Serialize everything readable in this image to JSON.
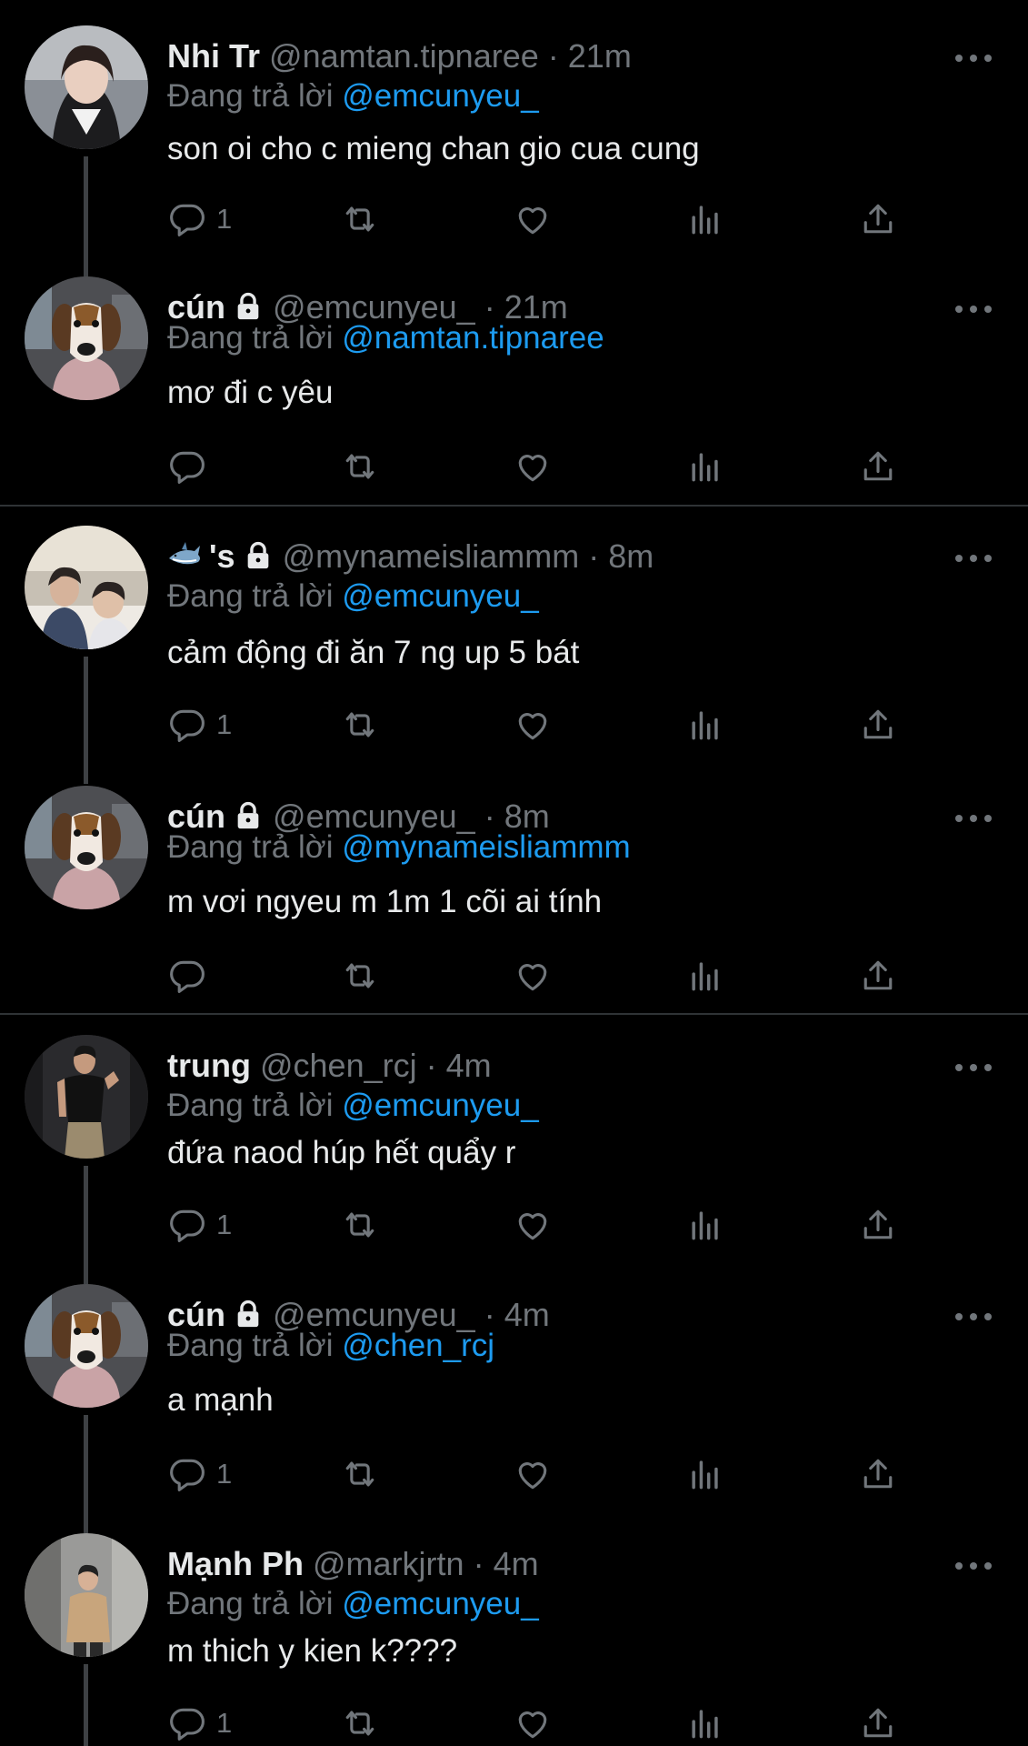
{
  "labels": {
    "replying_to": "Đang trả lời"
  },
  "colors": {
    "background": "#000000",
    "text": "#e7e9ea",
    "muted": "#71767b",
    "link": "#1d9bf0",
    "thread_line": "#3e4144"
  },
  "tweets": [
    {
      "name": "Nhi Tr",
      "handle": "@namtan.tipnaree",
      "dot": "·",
      "time": "21m",
      "locked": false,
      "reply_to": "@emcunyeu_",
      "text": "son oi cho c mieng chan gio cua cung",
      "reply_count": "1",
      "avatar_icon": "portrait-girl-avatar"
    },
    {
      "name": "cún",
      "handle": "@emcunyeu_",
      "dot": "·",
      "time": "21m",
      "locked": true,
      "reply_to": "@namtan.tipnaree",
      "text": "mơ đi c yêu",
      "reply_count": "",
      "avatar_icon": "beagle-dog-avatar"
    },
    {
      "name": "'s",
      "name_emoji": "shark-emoji",
      "handle": "@mynameisliammm",
      "dot": "·",
      "time": "8m",
      "locked": true,
      "reply_to": "@emcunyeu_",
      "text": "cảm động đi ăn 7 ng up 5 bát",
      "reply_count": "1",
      "avatar_icon": "two-people-avatar"
    },
    {
      "name": "cún",
      "handle": "@emcunyeu_",
      "dot": "·",
      "time": "8m",
      "locked": true,
      "reply_to": "@mynameisliammm",
      "text": "m vơi ngyeu m 1m 1 cõi ai tính",
      "reply_count": "",
      "avatar_icon": "beagle-dog-avatar"
    },
    {
      "name": "trung",
      "handle": "@chen_rcj",
      "dot": "·",
      "time": "4m",
      "locked": false,
      "reply_to": "@emcunyeu_",
      "text": "đứa naod húp hết quẩy r",
      "reply_count": "1",
      "avatar_icon": "mirror-selfie-avatar"
    },
    {
      "name": "cún",
      "handle": "@emcunyeu_",
      "dot": "·",
      "time": "4m",
      "locked": true,
      "reply_to": "@chen_rcj",
      "text": "a mạnh",
      "reply_count": "1",
      "avatar_icon": "beagle-dog-avatar"
    },
    {
      "name": "Mạnh Ph",
      "handle": "@markjrtn",
      "dot": "·",
      "time": "4m",
      "locked": false,
      "reply_to": "@emcunyeu_",
      "text": "m thich y kien k????",
      "reply_count": "1",
      "avatar_icon": "street-photo-avatar"
    }
  ]
}
